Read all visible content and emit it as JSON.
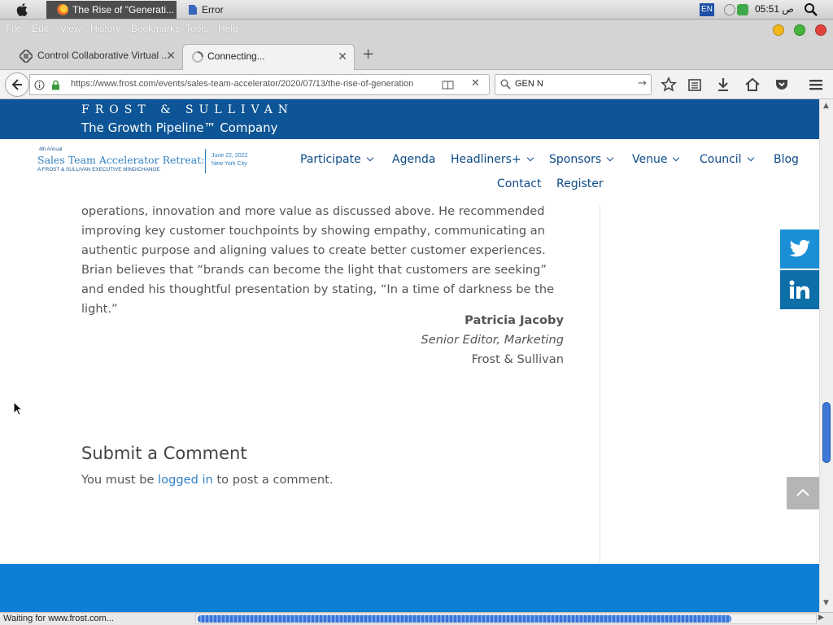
{
  "system": {
    "active_task": "The Rise of \"Generati...",
    "error_task": "Error",
    "keyboard_layout": "EN",
    "clock": "05:51 ص"
  },
  "menu": {
    "items": [
      "File",
      "Edit",
      "View",
      "History",
      "Bookmarks",
      "Tools",
      "Help"
    ],
    "accent_close": "#e0433a",
    "accent_min": "#f3b81c",
    "accent_max": "#44b53a"
  },
  "tabs": [
    {
      "label": "Control Collaborative Virtual ...",
      "icon": "virtualbox-icon"
    },
    {
      "label": "Connecting...",
      "icon": "loading-icon"
    }
  ],
  "navigation": {
    "url": "https://www.frost.com/events/sales-team-accelerator/2020/07/13/the-rise-of-generation",
    "search_value": "GEN N"
  },
  "site": {
    "brand_line1": "FROST & SULLIVAN",
    "brand_line2": "The Growth Pipeline™ Company",
    "event_logo": {
      "edition": "4th Annual",
      "name": "Sales Team Accelerator Retreat:",
      "tagline": "A FROST & SULLIVAN EXECUTIVE MIND/CHANGE",
      "date": "June 22, 2022",
      "city": "New York City"
    },
    "nav": {
      "participate": "Participate",
      "agenda": "Agenda",
      "headliners": "Headliners+",
      "sponsors": "Sponsors",
      "venue": "Venue",
      "council": "Council",
      "blog": "Blog",
      "contact": "Contact",
      "register": "Register"
    },
    "header_color": "#0d5596",
    "footer_color": "#0c7ed3"
  },
  "article": {
    "paragraph": "operations, innovation and more value as discussed above. He recommended improving key customer touchpoints by showing empathy, communicating an authentic purpose and aligning values to create better customer experiences. Brian believes that “brands can become the light that customers are seeking” and ended his thoughtful presentation by stating, “In a time of darkness be the light.”",
    "author_name": "Patricia Jacoby",
    "author_title": "Senior Editor, Marketing",
    "author_org": "Frost & Sullivan"
  },
  "comments": {
    "title": "Submit a Comment",
    "note_before": "You must be ",
    "note_link": "logged in",
    "note_after": " to post a comment."
  },
  "status": {
    "text": "Waiting for www.frost.com..."
  }
}
